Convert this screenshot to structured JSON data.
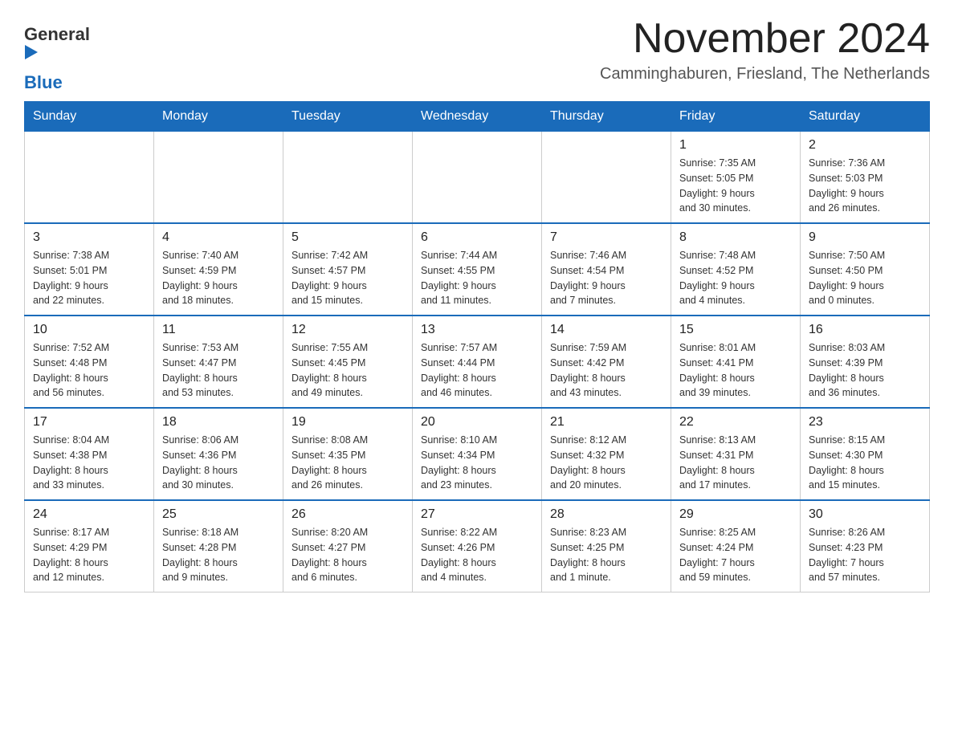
{
  "header": {
    "logo_general": "General",
    "logo_blue": "Blue",
    "month_title": "November 2024",
    "location": "Camminghaburen, Friesland, The Netherlands"
  },
  "weekdays": [
    "Sunday",
    "Monday",
    "Tuesday",
    "Wednesday",
    "Thursday",
    "Friday",
    "Saturday"
  ],
  "weeks": [
    [
      {
        "day": "",
        "info": ""
      },
      {
        "day": "",
        "info": ""
      },
      {
        "day": "",
        "info": ""
      },
      {
        "day": "",
        "info": ""
      },
      {
        "day": "",
        "info": ""
      },
      {
        "day": "1",
        "info": "Sunrise: 7:35 AM\nSunset: 5:05 PM\nDaylight: 9 hours\nand 30 minutes."
      },
      {
        "day": "2",
        "info": "Sunrise: 7:36 AM\nSunset: 5:03 PM\nDaylight: 9 hours\nand 26 minutes."
      }
    ],
    [
      {
        "day": "3",
        "info": "Sunrise: 7:38 AM\nSunset: 5:01 PM\nDaylight: 9 hours\nand 22 minutes."
      },
      {
        "day": "4",
        "info": "Sunrise: 7:40 AM\nSunset: 4:59 PM\nDaylight: 9 hours\nand 18 minutes."
      },
      {
        "day": "5",
        "info": "Sunrise: 7:42 AM\nSunset: 4:57 PM\nDaylight: 9 hours\nand 15 minutes."
      },
      {
        "day": "6",
        "info": "Sunrise: 7:44 AM\nSunset: 4:55 PM\nDaylight: 9 hours\nand 11 minutes."
      },
      {
        "day": "7",
        "info": "Sunrise: 7:46 AM\nSunset: 4:54 PM\nDaylight: 9 hours\nand 7 minutes."
      },
      {
        "day": "8",
        "info": "Sunrise: 7:48 AM\nSunset: 4:52 PM\nDaylight: 9 hours\nand 4 minutes."
      },
      {
        "day": "9",
        "info": "Sunrise: 7:50 AM\nSunset: 4:50 PM\nDaylight: 9 hours\nand 0 minutes."
      }
    ],
    [
      {
        "day": "10",
        "info": "Sunrise: 7:52 AM\nSunset: 4:48 PM\nDaylight: 8 hours\nand 56 minutes."
      },
      {
        "day": "11",
        "info": "Sunrise: 7:53 AM\nSunset: 4:47 PM\nDaylight: 8 hours\nand 53 minutes."
      },
      {
        "day": "12",
        "info": "Sunrise: 7:55 AM\nSunset: 4:45 PM\nDaylight: 8 hours\nand 49 minutes."
      },
      {
        "day": "13",
        "info": "Sunrise: 7:57 AM\nSunset: 4:44 PM\nDaylight: 8 hours\nand 46 minutes."
      },
      {
        "day": "14",
        "info": "Sunrise: 7:59 AM\nSunset: 4:42 PM\nDaylight: 8 hours\nand 43 minutes."
      },
      {
        "day": "15",
        "info": "Sunrise: 8:01 AM\nSunset: 4:41 PM\nDaylight: 8 hours\nand 39 minutes."
      },
      {
        "day": "16",
        "info": "Sunrise: 8:03 AM\nSunset: 4:39 PM\nDaylight: 8 hours\nand 36 minutes."
      }
    ],
    [
      {
        "day": "17",
        "info": "Sunrise: 8:04 AM\nSunset: 4:38 PM\nDaylight: 8 hours\nand 33 minutes."
      },
      {
        "day": "18",
        "info": "Sunrise: 8:06 AM\nSunset: 4:36 PM\nDaylight: 8 hours\nand 30 minutes."
      },
      {
        "day": "19",
        "info": "Sunrise: 8:08 AM\nSunset: 4:35 PM\nDaylight: 8 hours\nand 26 minutes."
      },
      {
        "day": "20",
        "info": "Sunrise: 8:10 AM\nSunset: 4:34 PM\nDaylight: 8 hours\nand 23 minutes."
      },
      {
        "day": "21",
        "info": "Sunrise: 8:12 AM\nSunset: 4:32 PM\nDaylight: 8 hours\nand 20 minutes."
      },
      {
        "day": "22",
        "info": "Sunrise: 8:13 AM\nSunset: 4:31 PM\nDaylight: 8 hours\nand 17 minutes."
      },
      {
        "day": "23",
        "info": "Sunrise: 8:15 AM\nSunset: 4:30 PM\nDaylight: 8 hours\nand 15 minutes."
      }
    ],
    [
      {
        "day": "24",
        "info": "Sunrise: 8:17 AM\nSunset: 4:29 PM\nDaylight: 8 hours\nand 12 minutes."
      },
      {
        "day": "25",
        "info": "Sunrise: 8:18 AM\nSunset: 4:28 PM\nDaylight: 8 hours\nand 9 minutes."
      },
      {
        "day": "26",
        "info": "Sunrise: 8:20 AM\nSunset: 4:27 PM\nDaylight: 8 hours\nand 6 minutes."
      },
      {
        "day": "27",
        "info": "Sunrise: 8:22 AM\nSunset: 4:26 PM\nDaylight: 8 hours\nand 4 minutes."
      },
      {
        "day": "28",
        "info": "Sunrise: 8:23 AM\nSunset: 4:25 PM\nDaylight: 8 hours\nand 1 minute."
      },
      {
        "day": "29",
        "info": "Sunrise: 8:25 AM\nSunset: 4:24 PM\nDaylight: 7 hours\nand 59 minutes."
      },
      {
        "day": "30",
        "info": "Sunrise: 8:26 AM\nSunset: 4:23 PM\nDaylight: 7 hours\nand 57 minutes."
      }
    ]
  ]
}
